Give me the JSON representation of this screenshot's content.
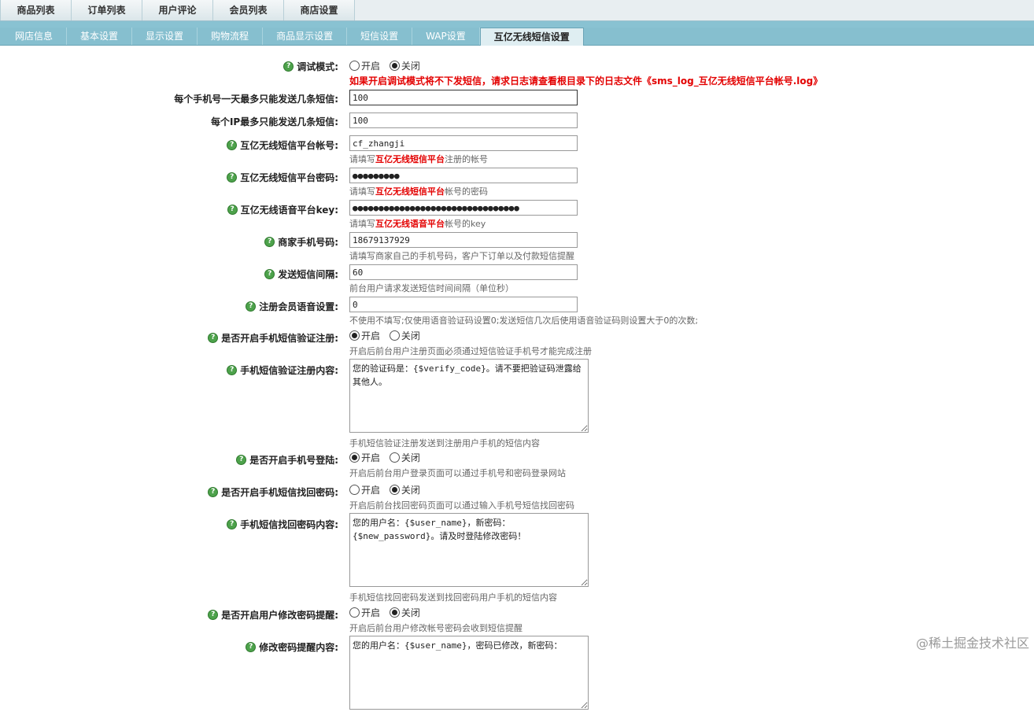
{
  "top_tabs": [
    "商品列表",
    "订单列表",
    "用户评论",
    "会员列表",
    "商店设置"
  ],
  "sub_tabs": [
    "网店信息",
    "基本设置",
    "显示设置",
    "购物流程",
    "商品显示设置",
    "短信设置",
    "WAP设置",
    "互亿无线短信设置"
  ],
  "form": {
    "debug": {
      "label": "调试模式:",
      "on": "开启",
      "off": "关闭",
      "warn": "如果开启调试模式将不下发短信，请求日志请查看根目录下的日志文件《sms_log_互亿无线短信平台帐号.log》"
    },
    "per_phone": {
      "label": "每个手机号一天最多只能发送几条短信:",
      "value": "100"
    },
    "per_ip": {
      "label": "每个IP最多只能发送几条短信:",
      "value": "100"
    },
    "account": {
      "label": "互亿无线短信平台帐号:",
      "value": "cf_zhangji",
      "note_pre": "请填写",
      "note_em": "互亿无线短信平台",
      "note_post": "注册的帐号"
    },
    "password": {
      "label": "互亿无线短信平台密码:",
      "value": "●●●●●●●●●",
      "note_pre": "请填写",
      "note_em": "互亿无线短信平台",
      "note_post": "帐号的密码"
    },
    "voice_key": {
      "label": "互亿无线语音平台key:",
      "value": "●●●●●●●●●●●●●●●●●●●●●●●●●●●●●●●●",
      "note_pre": "请填写",
      "note_em": "互亿无线语音平台",
      "note_post": "帐号的key"
    },
    "shop_phone": {
      "label": "商家手机号码:",
      "value": "18679137929",
      "note": "请填写商家自己的手机号码，客户下订单以及付款短信提醒"
    },
    "interval": {
      "label": "发送短信间隔:",
      "value": "60",
      "note": "前台用户请求发送短信时间间隔（单位秒）"
    },
    "voice_reg": {
      "label": "注册会员语音设置:",
      "value": "0",
      "note": "不使用不填写;仅使用语音验证码设置0;发送短信几次后使用语音验证码则设置大于0的次数;"
    },
    "sms_reg": {
      "label": "是否开启手机短信验证注册:",
      "on": "开启",
      "off": "关闭",
      "note": "开启后前台用户注册页面必须通过短信验证手机号才能完成注册"
    },
    "reg_content": {
      "label": "手机短信验证注册内容:",
      "value": "您的验证码是：{$verify_code}。请不要把验证码泄露给其他人。",
      "note": "手机短信验证注册发送到注册用户手机的短信内容"
    },
    "phone_login": {
      "label": "是否开启手机号登陆:",
      "on": "开启",
      "off": "关闭",
      "note": "开启后前台用户登录页面可以通过手机号和密码登录网站"
    },
    "find_pwd": {
      "label": "是否开启手机短信找回密码:",
      "on": "开启",
      "off": "关闭",
      "note": "开启后前台找回密码页面可以通过输入手机号短信找回密码"
    },
    "find_content": {
      "label": "手机短信找回密码内容:",
      "value": "您的用户名：{$user_name}，新密码：{$new_password}。请及时登陆修改密码！",
      "note": "手机短信找回密码发送到找回密码用户手机的短信内容"
    },
    "pwd_remind": {
      "label": "是否开启用户修改密码提醒:",
      "on": "开启",
      "off": "关闭",
      "note": "开启后前台用户修改帐号密码会收到短信提醒"
    },
    "remind_content": {
      "label": "修改密码提醒内容:",
      "value": "您的用户名：{$user_name}，密码已修改，新密码："
    }
  },
  "watermark": "@稀土掘金技术社区"
}
